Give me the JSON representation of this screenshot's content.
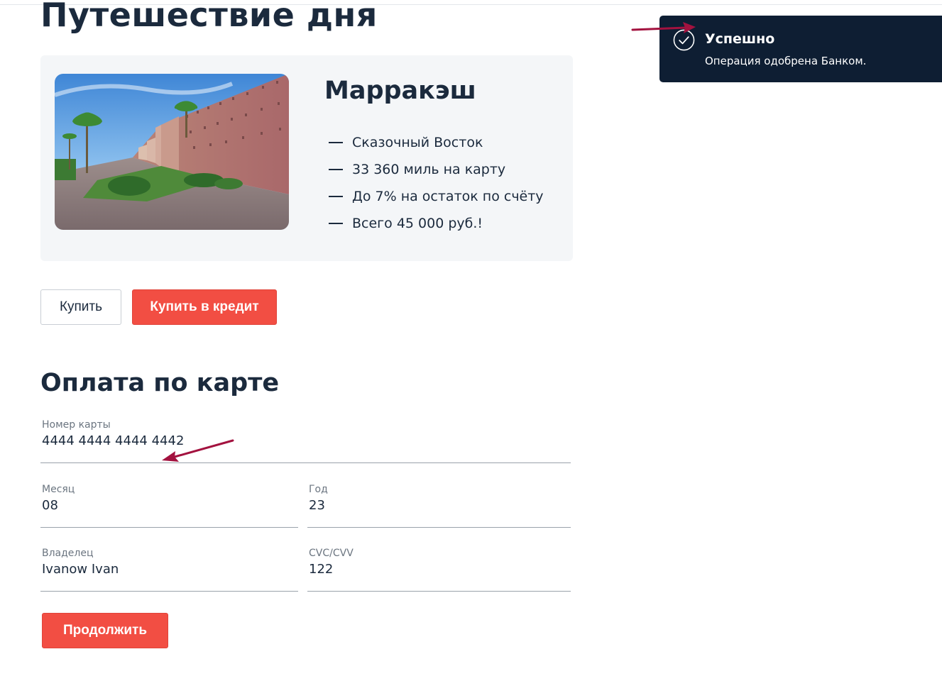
{
  "offer": {
    "section_title": "Путешествие дня",
    "city": "Марракэш",
    "features": [
      "Сказочный Восток",
      "33 360 миль на карту",
      "До 7% на остаток по счёту",
      "Всего 45 000 руб.!"
    ]
  },
  "actions": {
    "buy_label": "Купить",
    "buy_credit_label": "Купить в кредит"
  },
  "payment": {
    "title": "Оплата по карте",
    "card_number": {
      "label": "Номер карты",
      "value": "4444 4444 4444 4442"
    },
    "month": {
      "label": "Месяц",
      "value": "08"
    },
    "year": {
      "label": "Год",
      "value": "23"
    },
    "owner": {
      "label": "Владелец",
      "value": "Ivanow Ivan"
    },
    "cvc": {
      "label": "CVC/CVV",
      "value": "122"
    },
    "continue_label": "Продолжить"
  },
  "notification": {
    "title": "Успешно",
    "message": "Операция одобрена Банком.",
    "icon": "check-circle-icon"
  },
  "colors": {
    "accent_red": "#f24e43",
    "text_dark": "#1b2a3d",
    "toast_bg": "#0e1e33",
    "annotation_arrow": "#a3123f"
  }
}
